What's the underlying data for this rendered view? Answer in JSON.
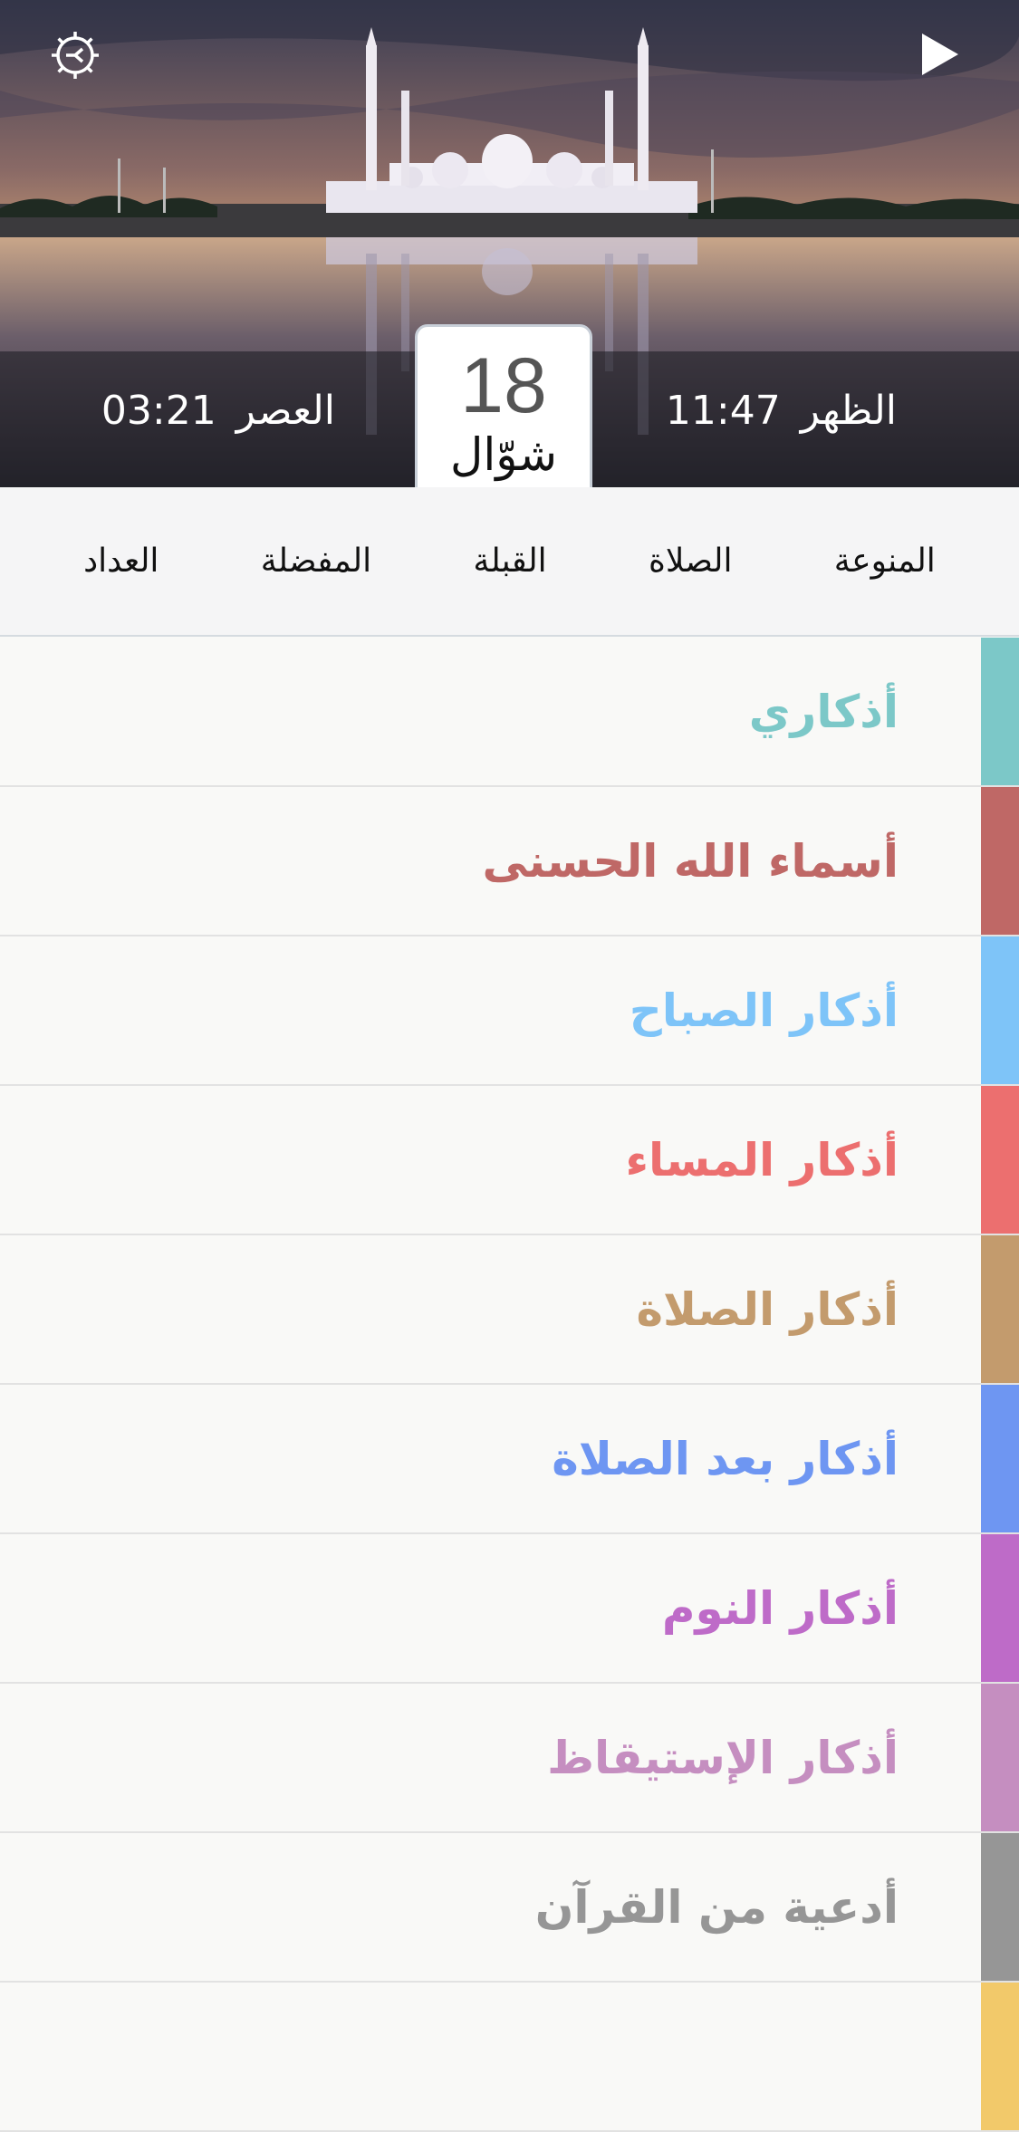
{
  "header": {
    "settings_icon": "settings-gear-icon",
    "play_icon": "play-icon",
    "date": {
      "day": "18",
      "month": "شوّال"
    },
    "prayers": [
      {
        "name": "الظهر",
        "time": "11:47"
      },
      {
        "name": "العصر",
        "time": "03:21"
      }
    ]
  },
  "tabs": [
    "المنوعة",
    "الصلاة",
    "القبلة",
    "المفضلة",
    "العداد"
  ],
  "list": [
    {
      "label": "أذكاري",
      "color": "#7cc8c8"
    },
    {
      "label": "أسماء الله الحسنى",
      "color": "#bf6866"
    },
    {
      "label": "أذكار الصباح",
      "color": "#7ec4f8"
    },
    {
      "label": "أذكار المساء",
      "color": "#ec6f6f"
    },
    {
      "label": "أذكار الصلاة",
      "color": "#c39b6d"
    },
    {
      "label": "أذكار بعد الصلاة",
      "color": "#6e96f2"
    },
    {
      "label": "أذكار النوم",
      "color": "#be6bc8"
    },
    {
      "label": "أذكار الإستيقاظ",
      "color": "#c58ec0"
    },
    {
      "label": "أدعية من القرآن",
      "color": "#969696"
    },
    {
      "label": "",
      "color": "#f2c96a"
    }
  ]
}
